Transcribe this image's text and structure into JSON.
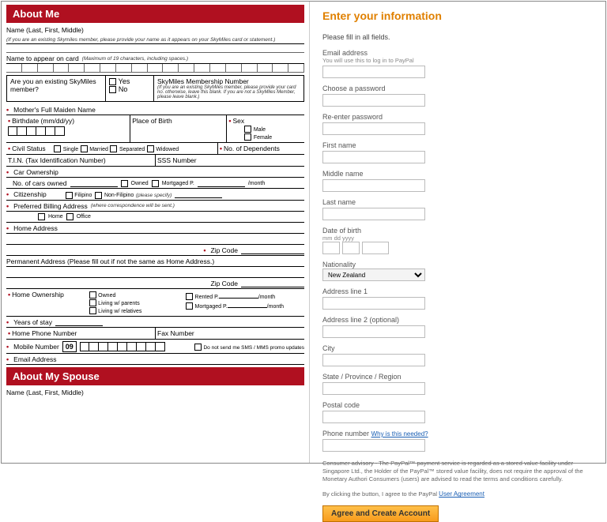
{
  "left": {
    "header1": "About Me",
    "name_label": "Name (Last, First, Middle)",
    "name_hint": "(If you are an existing Skymiles member, please provide your name as it appears on your SkyMiles card or statement.)",
    "card_name_label": "Name to appear on card",
    "card_name_hint": "(Maximum of 19 characters, including spaces.)",
    "skymiles_q": "Are you an existing SkyMiles member?",
    "yes": "Yes",
    "no": "No",
    "skymiles_num": "SkyMiles Membership Number",
    "skymiles_hint": "(If you are an existing SkyMiles member, please provide your card no. otherwise, leave this blank. If you are not a SkyMiles Member, please leave blank.)",
    "mother_maiden": "Mother's Full Maiden Name",
    "birthdate": "Birthdate (mm/dd/yy)",
    "place_birth": "Place of Birth",
    "sex": "Sex",
    "male": "Male",
    "female": "Female",
    "civil": "Civil Status",
    "single": "Single",
    "married": "Married",
    "separated": "Separated",
    "widowed": "Widowed",
    "dependents": "No. of Dependents",
    "tin": "T.I.N. (Tax Identification Number)",
    "sss": "SSS Number",
    "car": "Car Ownership",
    "cars_owned": "No. of cars owned",
    "owned": "Owned",
    "mortgaged_p": "Mortgaged P.",
    "per_month": "/month",
    "citizenship": "Citizenship",
    "filipino": "Filipino",
    "nonfilipino": "Non-Filipino",
    "nonfil_hint": "(please specify)",
    "billing": "Preferred Billing Address",
    "billing_hint": "(where correspondence will be sent.)",
    "home": "Home",
    "office": "Office",
    "home_addr": "Home Address",
    "zip": "Zip Code",
    "perm_addr": "Permanent Address (Please fill out if not the same as Home Address.)",
    "home_own": "Home Ownership",
    "owned2": "Owned",
    "living_parents": "Living w/ parents",
    "living_relatives": "Living w/ relatives",
    "rented_p": "Rented P.",
    "mortgaged_p2": "Mortgaged P.",
    "years_stay": "Years of stay",
    "home_phone": "Home Phone Number",
    "fax": "Fax Number",
    "mobile": "Mobile Number",
    "mobile_prefix": "09",
    "sms_opt": "Do not send me SMS / MMS promo updates",
    "email": "Email Address",
    "header2": "About My Spouse",
    "spouse_name": "Name (Last, First, Middle)"
  },
  "right": {
    "title": "Enter your information",
    "fill_all": "Please fill in all fields.",
    "email": "Email address",
    "email_hint": "You will use this to log in to PayPal",
    "choose_pw": "Choose a password",
    "reenter_pw": "Re-enter password",
    "first_name": "First name",
    "middle_name": "Middle name",
    "last_name": "Last name",
    "dob": "Date of birth",
    "dob_hint": "mm   dd   yyyy",
    "nationality": "Nationality",
    "nationality_val": "New Zealand",
    "addr1": "Address line 1",
    "addr2": "Address line 2 (optional)",
    "city": "City",
    "state": "State / Province / Region",
    "postal": "Postal code",
    "phone": "Phone number",
    "why_needed": "Why is this needed?",
    "advisory": "Consumer advisory - The PayPal™ payment service is regarded as a stored value facility under Singapore Ltd., the Holder of the PayPal™ stored value facility, does not require the approval of the Monetary Authori Consumers (users) are advised to read the terms and conditions carefully.",
    "agree_text": "By clicking the button, I agree to the PayPal ",
    "user_agreement": "User Agreement",
    "button": "Agree and Create Account"
  }
}
